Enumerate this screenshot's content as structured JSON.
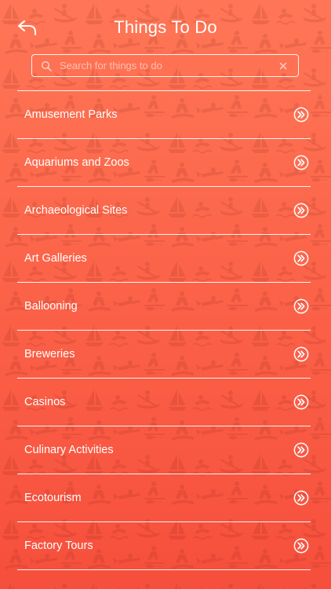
{
  "header": {
    "title": "Things To Do",
    "back_icon": "back-arrow-icon"
  },
  "search": {
    "placeholder": "Search for things to do",
    "value": "",
    "icon": "search-icon",
    "clear_icon": "close-icon"
  },
  "list": {
    "items": [
      {
        "label": "Amusement Parks"
      },
      {
        "label": "Aquariums and Zoos"
      },
      {
        "label": "Archaeological Sites"
      },
      {
        "label": "Art Galleries"
      },
      {
        "label": "Ballooning"
      },
      {
        "label": "Breweries"
      },
      {
        "label": "Casinos"
      },
      {
        "label": "Culinary Activities"
      },
      {
        "label": "Ecotourism"
      },
      {
        "label": "Factory Tours"
      }
    ],
    "item_icon": "double-chevron-right-icon"
  },
  "colors": {
    "background_top": "#ff7656",
    "background_bottom": "#f64f3c",
    "foreground": "#ffffff"
  }
}
